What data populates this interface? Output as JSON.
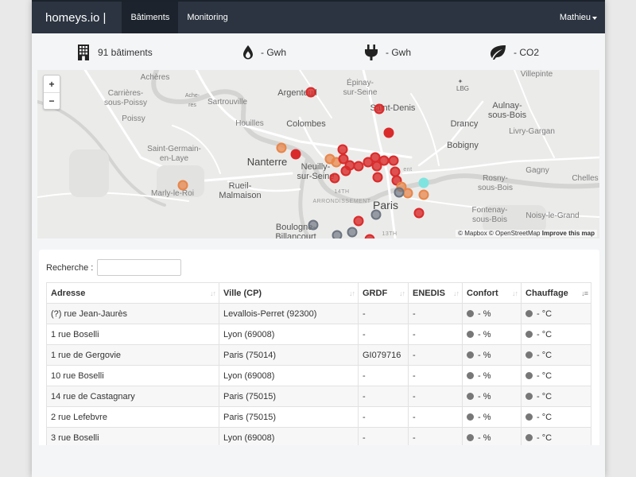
{
  "navbar": {
    "brand": "homeys.io |",
    "items": [
      {
        "label": "Bâtiments"
      },
      {
        "label": "Monitoring"
      }
    ],
    "user": "Mathieu"
  },
  "stats": {
    "buildings": {
      "icon": "building-icon",
      "text": "91 bâtiments"
    },
    "gas": {
      "icon": "flame-icon",
      "text": "- Gwh"
    },
    "electricity": {
      "icon": "plug-icon",
      "text": "- Gwh"
    },
    "co2": {
      "icon": "leaf-icon",
      "text": "- CO2"
    }
  },
  "map": {
    "zoom_in": "+",
    "zoom_out": "−",
    "compass": "LBG",
    "attribution_prefix": "© Mapbox © OpenStreetMap",
    "attribution_link": "Improve this map",
    "places": [
      "Achères",
      "Carrières-\nsous-Poissy",
      "Poissy",
      "Sartrouville",
      "Argenteuil",
      "Épinay-\nsur-Seine",
      "Saint-Denis",
      "Villepinte",
      "Aulnay-\nsous-Bois",
      "Drancy",
      "Livry-Gargan",
      "Houilles",
      "Colombes",
      "Bobigny",
      "Saint-Germain-\nen-Laye",
      "Nanterre",
      "Neuilly-\nsur-Seine",
      "Gagny",
      "Rosny-\nsous-Bois",
      "Chelles",
      "Rueil-\nMalmaison",
      "Marly-le-Roi",
      "Paris",
      "Fontenay-\nsous-Bois",
      "Noisy-le-Grand",
      "Boulogne-\nBillancourt",
      "14TH\nARRONDISSEMENT",
      "13TH",
      "ent",
      "Ache-\nres"
    ],
    "marker_colors": {
      "red": "#d92b2b",
      "orange": "#e8864a",
      "gray": "#6c7480",
      "cyan": "#7fe4e0"
    }
  },
  "table": {
    "search_label": "Recherche :",
    "search_value": "",
    "headers": [
      "Adresse",
      "Ville (CP)",
      "GRDF",
      "ENEDIS",
      "Confort",
      "Chauffage"
    ],
    "rows": [
      {
        "adresse": "(?) rue Jean-Jaurès",
        "ville": "Levallois-Perret (92300)",
        "grdf": "-",
        "enedis": "-",
        "confort": "- %",
        "chauffage": "- °C"
      },
      {
        "adresse": "1 rue Boselli",
        "ville": "Lyon (69008)",
        "grdf": "-",
        "enedis": "-",
        "confort": "- %",
        "chauffage": "- °C"
      },
      {
        "adresse": "1 rue de Gergovie",
        "ville": "Paris (75014)",
        "grdf": "GI079716",
        "enedis": "-",
        "confort": "- %",
        "chauffage": "- °C"
      },
      {
        "adresse": "10 rue Boselli",
        "ville": "Lyon (69008)",
        "grdf": "-",
        "enedis": "-",
        "confort": "- %",
        "chauffage": "- °C"
      },
      {
        "adresse": "14 rue de Castagnary",
        "ville": "Paris (75015)",
        "grdf": "-",
        "enedis": "-",
        "confort": "- %",
        "chauffage": "- °C"
      },
      {
        "adresse": "2 rue Lefebvre",
        "ville": "Paris (75015)",
        "grdf": "-",
        "enedis": "-",
        "confort": "- %",
        "chauffage": "- °C"
      },
      {
        "adresse": "3 rue Boselli",
        "ville": "Lyon (69008)",
        "grdf": "-",
        "enedis": "-",
        "confort": "- %",
        "chauffage": "- °C"
      }
    ]
  }
}
